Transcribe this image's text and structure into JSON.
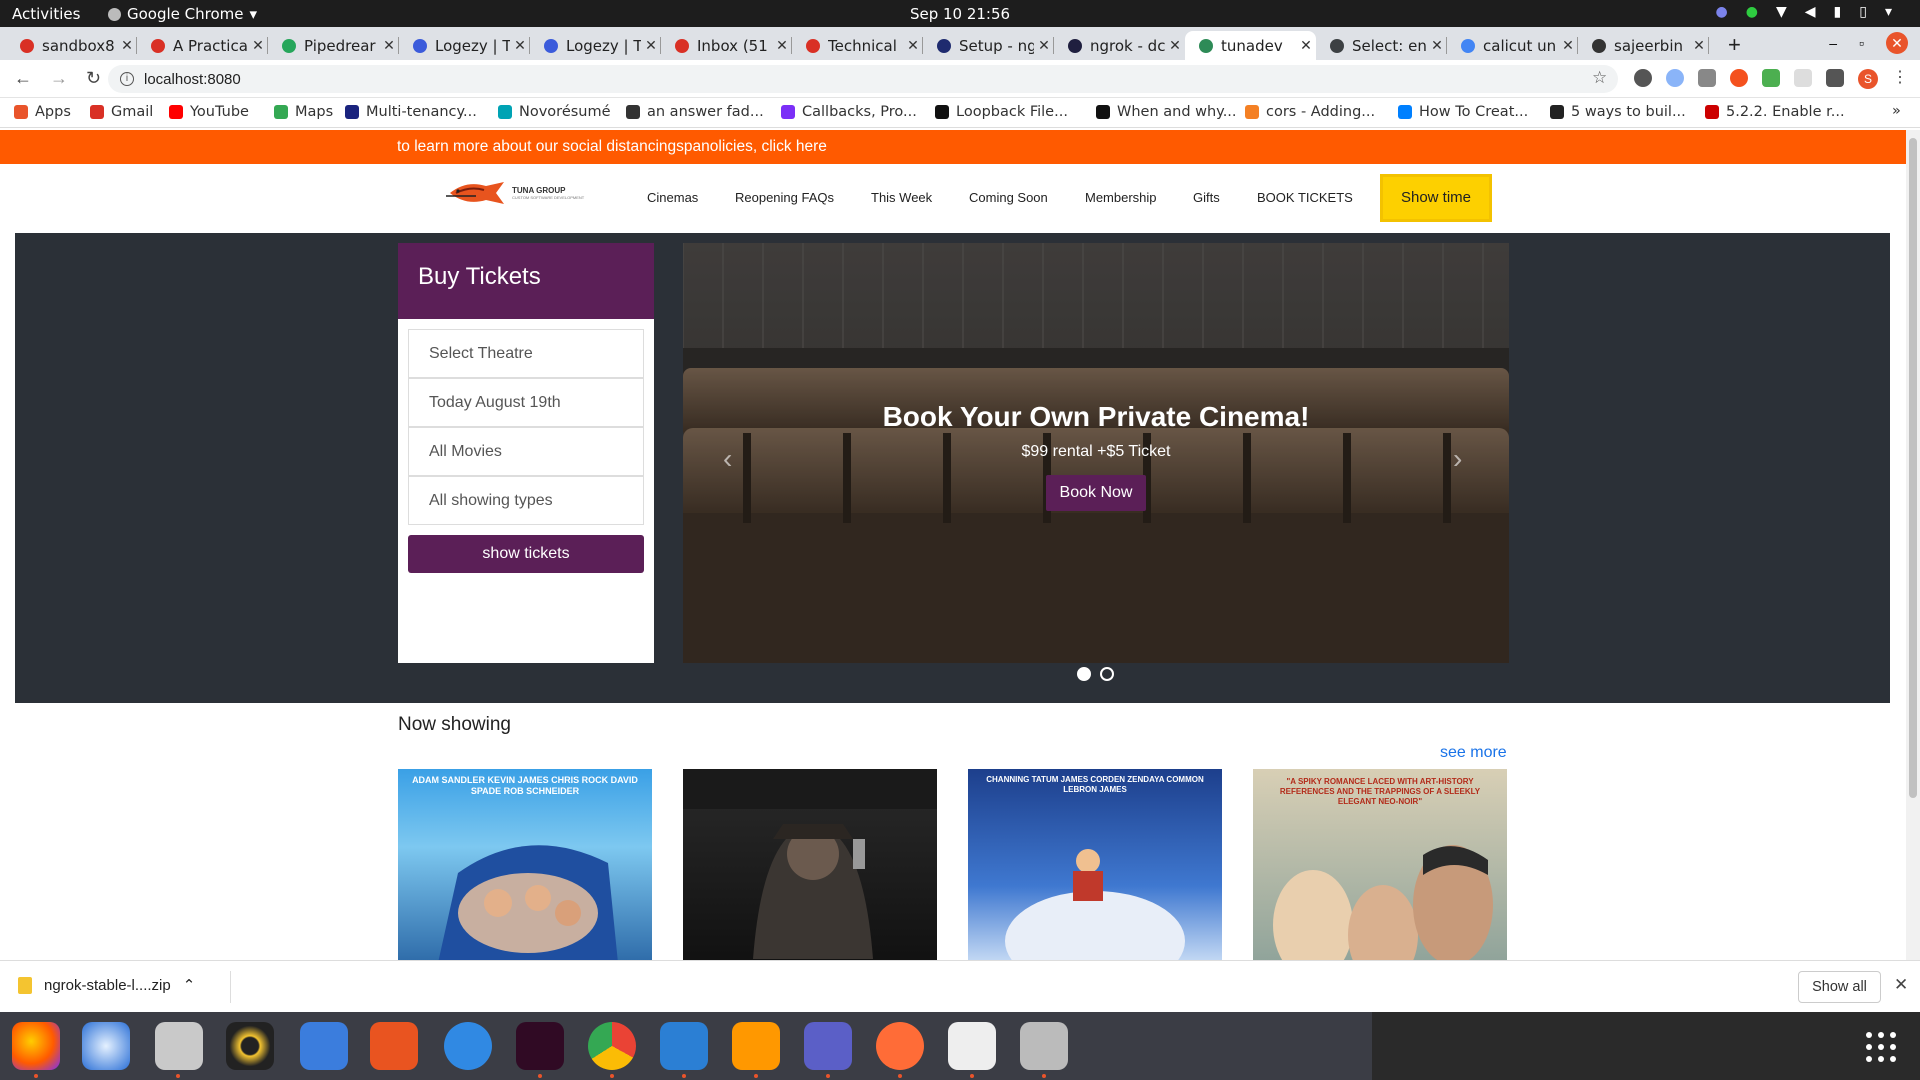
{
  "system": {
    "activities": "Activities",
    "app_name": "Google Chrome",
    "clock": "Sep 10  21:56"
  },
  "tabs": [
    {
      "title": "sandbox8",
      "color": "#d93025"
    },
    {
      "title": "A Practica",
      "color": "#d93025"
    },
    {
      "title": "Pipedrear",
      "color": "#26a65b"
    },
    {
      "title": "Logezy | T",
      "color": "#3b5bdb"
    },
    {
      "title": "Logezy | T",
      "color": "#3b5bdb"
    },
    {
      "title": "Inbox (51",
      "color": "#d93025"
    },
    {
      "title": "Technical",
      "color": "#d93025"
    },
    {
      "title": "Setup - ng",
      "color": "#1f2b6f"
    },
    {
      "title": "ngrok - dc",
      "color": "#1f1f3f"
    },
    {
      "title": "tunadev",
      "color": "#2e8b57"
    },
    {
      "title": "Select: en",
      "color": "#3c4043"
    },
    {
      "title": "calicut un",
      "color": "#4285f4"
    },
    {
      "title": "sajeerbin",
      "color": "#333333"
    }
  ],
  "address": {
    "url": "localhost:8080"
  },
  "bookmarks": [
    {
      "label": "Apps",
      "color": "#e9542b"
    },
    {
      "label": "Gmail",
      "color": "#d93025"
    },
    {
      "label": "YouTube",
      "color": "#ff0000"
    },
    {
      "label": "Maps",
      "color": "#34a853"
    },
    {
      "label": "Multi-tenancy...",
      "color": "#1a237e"
    },
    {
      "label": "Novorésumé",
      "color": "#00a3b4"
    },
    {
      "label": "an answer fad...",
      "color": "#333333"
    },
    {
      "label": "Callbacks, Pro...",
      "color": "#7b2ff7"
    },
    {
      "label": "Loopback File...",
      "color": "#111111"
    },
    {
      "label": "When and why...",
      "color": "#111111"
    },
    {
      "label": "cors - Adding...",
      "color": "#f48024"
    },
    {
      "label": "How To Creat...",
      "color": "#0080ff"
    },
    {
      "label": "5 ways to buil...",
      "color": "#222222"
    },
    {
      "label": "5.2.2. Enable r...",
      "color": "#cc0000"
    }
  ],
  "site": {
    "banner": "to learn more about our social distancingspanolicies, click here",
    "logo_name": "TUNA GROUP",
    "logo_tagline": "CUSTOM SOFTWARE DEVELOPMENT",
    "nav": [
      "Cinemas",
      "Reopening FAQs",
      "This Week",
      "Coming Soon",
      "Membership",
      "Gifts",
      "BOOK TICKETS"
    ],
    "showtime": "Show time",
    "buy": {
      "title": "Buy Tickets",
      "options": [
        "Select Theatre",
        "Today August 19th",
        "All Movies",
        "All showing types"
      ],
      "button": "show tickets"
    },
    "slide": {
      "headline": "Book Your Own Private Cinema!",
      "subline": "$99 rental +$5 Ticket",
      "cta": "Book Now"
    },
    "now_showing": "Now showing",
    "see_more": "see more",
    "posters": [
      {
        "name": "grown-ups-2-poster",
        "caption": "ADAM SANDLER  KEVIN JAMES  CHRIS ROCK  DAVID SPADE  ROB SCHNEIDER"
      },
      {
        "name": "action-movie-poster",
        "caption": ""
      },
      {
        "name": "smallfoot-poster",
        "caption": "CHANNING TATUM  JAMES CORDEN  ZENDAYA  COMMON  LEBRON JAMES"
      },
      {
        "name": "burnt-orange-heresy-poster",
        "caption": "\"A SPIKY ROMANCE LACED WITH ART-HISTORY REFERENCES AND THE TRAPPINGS OF A SLEEKLY ELEGANT NEO-NOIR\""
      }
    ]
  },
  "download": {
    "file": "ngrok-stable-l....zip",
    "show_all": "Show all"
  }
}
